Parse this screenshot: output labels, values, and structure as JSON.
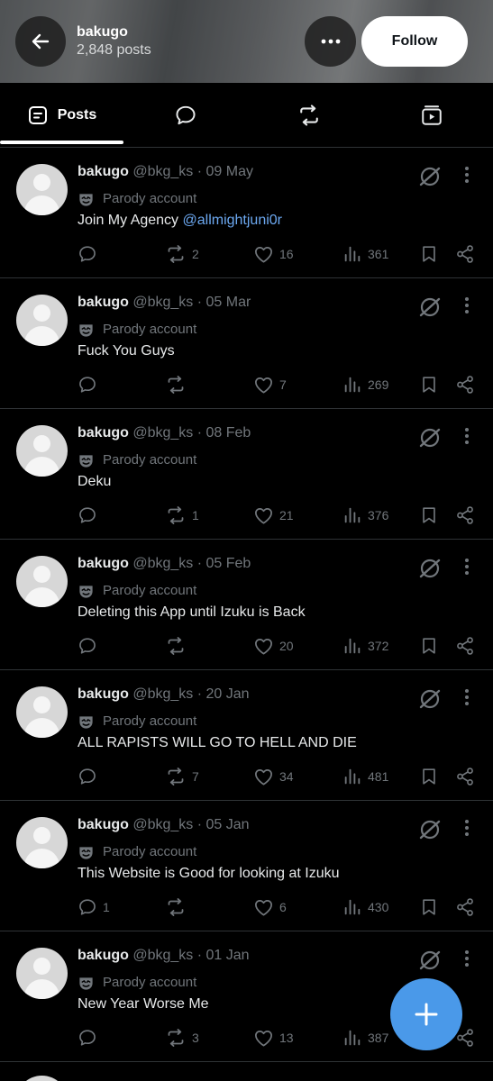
{
  "header": {
    "name": "bakugo",
    "post_count": "2,848 posts",
    "follow_label": "Follow"
  },
  "tabs": [
    {
      "label": "Posts",
      "icon": "posts-icon",
      "selected": true
    },
    {
      "label": "",
      "icon": "replies-icon",
      "selected": false
    },
    {
      "label": "",
      "icon": "reposts-icon",
      "selected": false
    },
    {
      "label": "",
      "icon": "media-icon",
      "selected": false
    }
  ],
  "posts": [
    {
      "name": "bakugo",
      "handle": "@bkg_ks",
      "sep": " · ",
      "date": "09 May",
      "parody": "Parody account",
      "text": "Join My Agency ",
      "mention": "@allmightjuni0r",
      "replies": "",
      "reposts": "2",
      "likes": "16",
      "views": "361"
    },
    {
      "name": "bakugo",
      "handle": "@bkg_ks",
      "sep": " · ",
      "date": "05 Mar",
      "parody": "Parody account",
      "text": "Fuck You Guys",
      "mention": "",
      "replies": "",
      "reposts": "",
      "likes": "7",
      "views": "269"
    },
    {
      "name": "bakugo",
      "handle": "@bkg_ks",
      "sep": " · ",
      "date": "08 Feb",
      "parody": "Parody account",
      "text": "Deku",
      "mention": "",
      "replies": "",
      "reposts": "1",
      "likes": "21",
      "views": "376"
    },
    {
      "name": "bakugo",
      "handle": "@bkg_ks",
      "sep": " · ",
      "date": "05 Feb",
      "parody": "Parody account",
      "text": "Deleting this App until Izuku is Back",
      "mention": "",
      "replies": "",
      "reposts": "",
      "likes": "20",
      "views": "372"
    },
    {
      "name": "bakugo",
      "handle": "@bkg_ks",
      "sep": " · ",
      "date": "20 Jan",
      "parody": "Parody account",
      "text": "ALL RAPISTS WILL GO TO HELL AND DIE",
      "mention": "",
      "replies": "",
      "reposts": "7",
      "likes": "34",
      "views": "481"
    },
    {
      "name": "bakugo",
      "handle": "@bkg_ks",
      "sep": " · ",
      "date": "05 Jan",
      "parody": "Parody account",
      "text": "This Website is Good for looking at Izuku",
      "mention": "",
      "replies": "1",
      "reposts": "",
      "likes": "6",
      "views": "430"
    },
    {
      "name": "bakugo",
      "handle": "@bkg_ks",
      "sep": " · ",
      "date": "01 Jan",
      "parody": "Parody account",
      "text": "New Year Worse Me",
      "mention": "",
      "replies": "",
      "reposts": "3",
      "likes": "13",
      "views": "387"
    }
  ],
  "colors": {
    "background": "#000000",
    "text": "#e7e9ea",
    "muted": "#71767b",
    "mention": "#6ca8f0",
    "fab": "#4a99e9",
    "divider": "#2f3336"
  }
}
